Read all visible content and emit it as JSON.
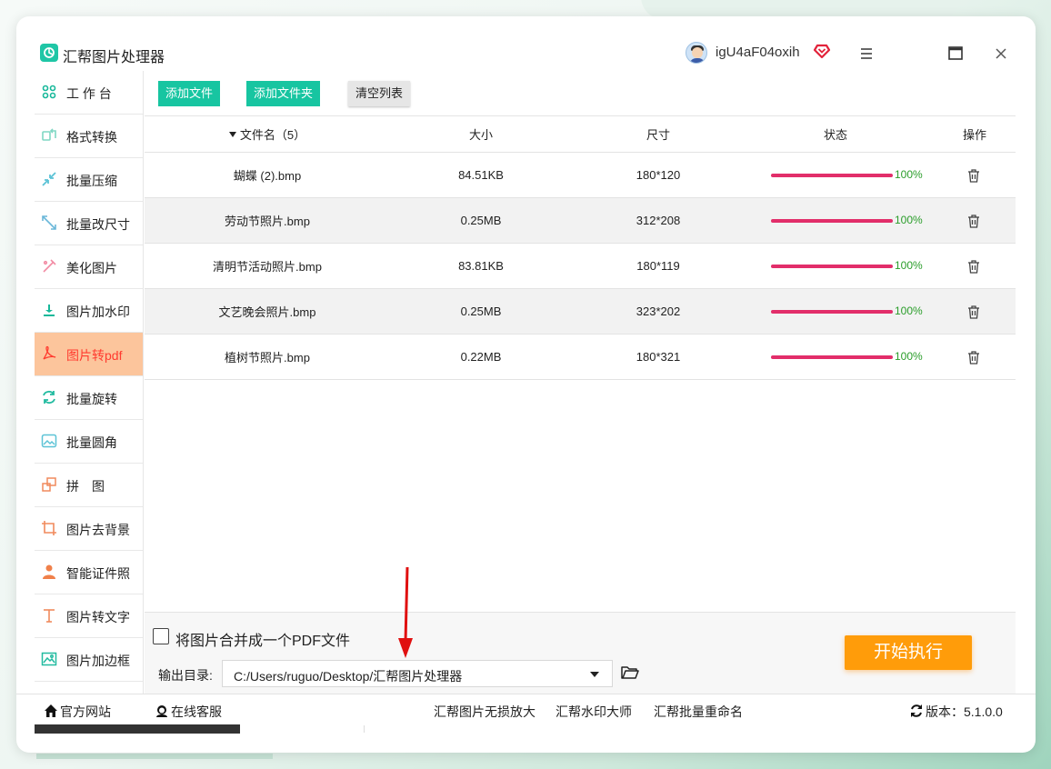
{
  "app": {
    "title": "汇帮图片处理器",
    "username": "igU4aF04oxih"
  },
  "sidebar": {
    "items": [
      {
        "label": "工 作 台",
        "icon": "grid-icon"
      },
      {
        "label": "格式转换",
        "icon": "convert-icon"
      },
      {
        "label": "批量压缩",
        "icon": "compress-icon"
      },
      {
        "label": "批量改尺寸",
        "icon": "resize-icon"
      },
      {
        "label": "美化图片",
        "icon": "beautify-icon"
      },
      {
        "label": "图片加水印",
        "icon": "watermark-icon"
      },
      {
        "label": "图片转pdf",
        "icon": "pdf-icon"
      },
      {
        "label": "批量旋转",
        "icon": "rotate-icon"
      },
      {
        "label": "批量圆角",
        "icon": "round-corner-icon"
      },
      {
        "label": "拼　图",
        "icon": "puzzle-icon"
      },
      {
        "label": "图片去背景",
        "icon": "crop-icon"
      },
      {
        "label": "智能证件照",
        "icon": "person-icon"
      },
      {
        "label": "图片转文字",
        "icon": "text-icon"
      },
      {
        "label": "图片加边框",
        "icon": "frame-icon"
      }
    ],
    "active_index": 6
  },
  "toolbar": {
    "add_file": "添加文件",
    "add_folder": "添加文件夹",
    "clear_list": "清空列表"
  },
  "table": {
    "headers": {
      "name": "文件名（5）",
      "size": "大小",
      "dim": "尺寸",
      "status": "状态",
      "op": "操作"
    },
    "rows": [
      {
        "name": "蝴蝶 (2).bmp",
        "size": "84.51KB",
        "dim": "180*120",
        "progress": "100%"
      },
      {
        "name": "劳动节照片.bmp",
        "size": "0.25MB",
        "dim": "312*208",
        "progress": "100%"
      },
      {
        "name": "清明节活动照片.bmp",
        "size": "83.81KB",
        "dim": "180*119",
        "progress": "100%"
      },
      {
        "name": "文艺晚会照片.bmp",
        "size": "0.25MB",
        "dim": "323*202",
        "progress": "100%"
      },
      {
        "name": "植树节照片.bmp",
        "size": "0.22MB",
        "dim": "180*321",
        "progress": "100%"
      }
    ]
  },
  "options": {
    "merge_label": "将图片合并成一个PDF文件",
    "merge_checked": false,
    "output_label": "输出目录:",
    "output_path": "C:/Users/ruguo/Desktop/汇帮图片处理器",
    "start_label": "开始执行"
  },
  "footer": {
    "website": "官方网站",
    "service": "在线客服",
    "links": [
      "汇帮图片无损放大",
      "汇帮水印大师",
      "汇帮批量重命名"
    ],
    "version": "版本：5.1.0.0"
  },
  "colors": {
    "accent": "#17c5a1",
    "start": "#ff9c0a",
    "progress": "#e22e6a",
    "active_bg": "#fcc59c"
  }
}
